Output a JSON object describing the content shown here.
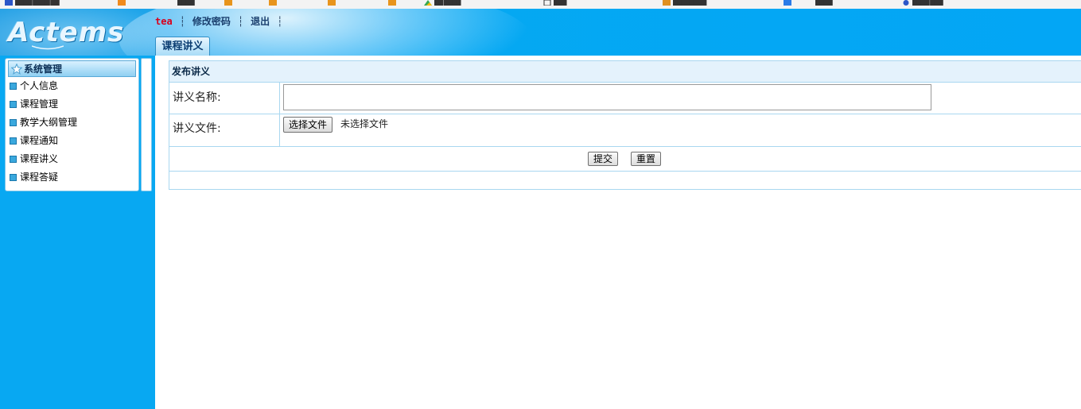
{
  "browser": {
    "bookmark_colors": [
      "#2a55c8",
      "#f08a1c",
      "#e8941c",
      "#e8941c",
      "#e8941c",
      "#e8941c",
      "#e09020",
      "#e8941c",
      "#e8941c",
      "#2a55c8"
    ]
  },
  "header": {
    "logo_text": "Actems",
    "user": "tea",
    "change_password": "修改密码",
    "logout": "退出",
    "separator": "┆",
    "active_tab": "课程讲义",
    "colors": {
      "header_blue": "#05a8f2",
      "user_red": "#d8001c",
      "link_navy": "#1a3f6e"
    }
  },
  "sidebar": {
    "title": "系统管理",
    "items": [
      {
        "label": "个人信息"
      },
      {
        "label": "课程管理"
      },
      {
        "label": "教学大纲管理"
      },
      {
        "label": "课程通知"
      },
      {
        "label": "课程讲义"
      },
      {
        "label": "课程答疑"
      }
    ]
  },
  "form": {
    "title": "发布讲义",
    "name_label": "讲义名称:",
    "name_value": "",
    "file_label": "讲义文件:",
    "file_button": "选择文件",
    "file_status": "未选择文件",
    "submit": "提交",
    "reset": "重置"
  }
}
